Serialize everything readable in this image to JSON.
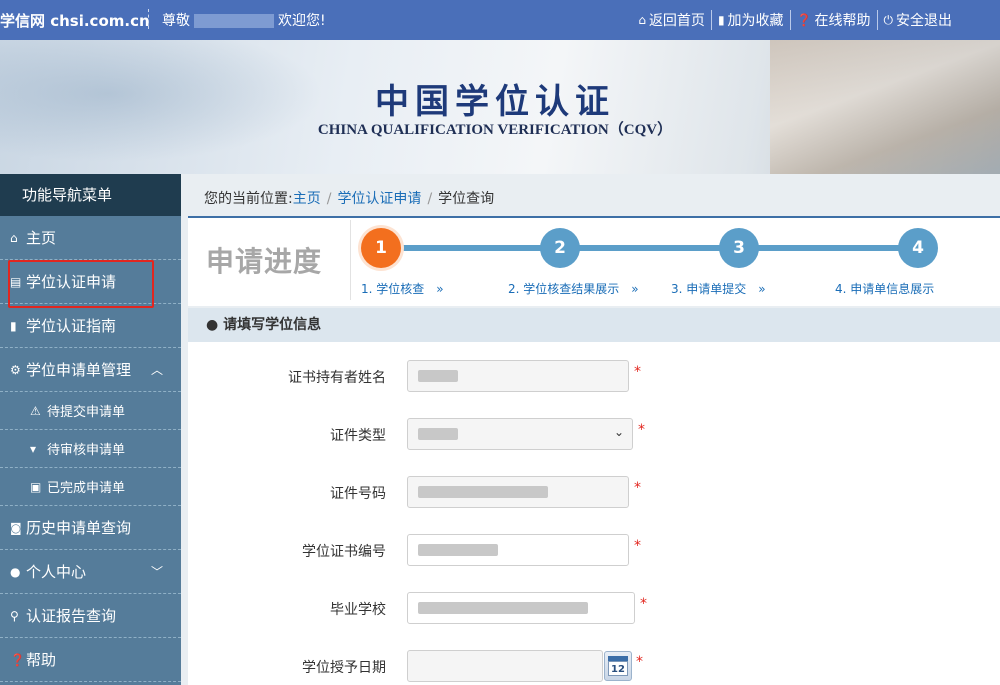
{
  "topbar": {
    "brand": "学信网 chsi.com.cn",
    "greeting_prefix": "尊敬",
    "greeting_suffix": "欢迎您!",
    "links": [
      {
        "label": "返回首页",
        "icon": "home-icon"
      },
      {
        "label": "加为收藏",
        "icon": "bookmark-icon"
      },
      {
        "label": "在线帮助",
        "icon": "help-icon"
      },
      {
        "label": "安全退出",
        "icon": "power-icon"
      }
    ]
  },
  "banner": {
    "title_cn": "中国学位认证",
    "title_en": "CHINA QUALIFICATION VERIFICATION（CQV）"
  },
  "sidebar": {
    "header": "功能导航菜单",
    "items": [
      {
        "label": "主页",
        "icon": "home-icon"
      },
      {
        "label": "学位认证申请",
        "icon": "file-icon"
      },
      {
        "label": "学位认证指南",
        "icon": "bookmark-icon"
      },
      {
        "label": "学位申请单管理",
        "icon": "gear-icon",
        "caret": "chevron-up-icon"
      },
      {
        "label": "待提交申请单",
        "icon": "warning-icon"
      },
      {
        "label": "待审核申请单",
        "icon": "cart-icon"
      },
      {
        "label": "已完成申请单",
        "icon": "briefcase-icon"
      },
      {
        "label": "历史申请单查询",
        "icon": "camera-icon"
      },
      {
        "label": "个人中心",
        "icon": "user-icon",
        "caret": "chevron-down-icon"
      },
      {
        "label": "认证报告查询",
        "icon": "search-icon"
      },
      {
        "label": "帮助",
        "icon": "help-icon"
      }
    ]
  },
  "breadcrumb": {
    "prefix": "您的当前位置:",
    "items": [
      "主页",
      "学位认证申请",
      "学位查询"
    ]
  },
  "progress": {
    "title": "申请进度",
    "current_step": 1,
    "steps": [
      {
        "num": "1",
        "label": "1. 学位核查　»"
      },
      {
        "num": "2",
        "label": "2. 学位核查结果展示　»"
      },
      {
        "num": "3",
        "label": "3. 申请单提交　»"
      },
      {
        "num": "4",
        "label": "4. 申请单信息展示"
      }
    ]
  },
  "form": {
    "section_title": "请填写学位信息",
    "fields": [
      {
        "label": "证书持有者姓名",
        "value": "",
        "required": "*"
      },
      {
        "label": "证件类型",
        "value": "",
        "required": "*"
      },
      {
        "label": "证件号码",
        "value": "",
        "required": "*"
      },
      {
        "label": "学位证书编号",
        "value": "",
        "required": "*"
      },
      {
        "label": "毕业学校",
        "value": "",
        "required": "*"
      },
      {
        "label": "学位授予日期",
        "value": "",
        "required": "*"
      }
    ],
    "calendar_day": "12"
  },
  "colors": {
    "topbar": "#4a6fb9",
    "sidebar": "#557c9a",
    "sidebar_header": "#1f3c4f",
    "active_step": "#f36f1e",
    "step": "#5b9ec9",
    "required": "#e2261f"
  }
}
